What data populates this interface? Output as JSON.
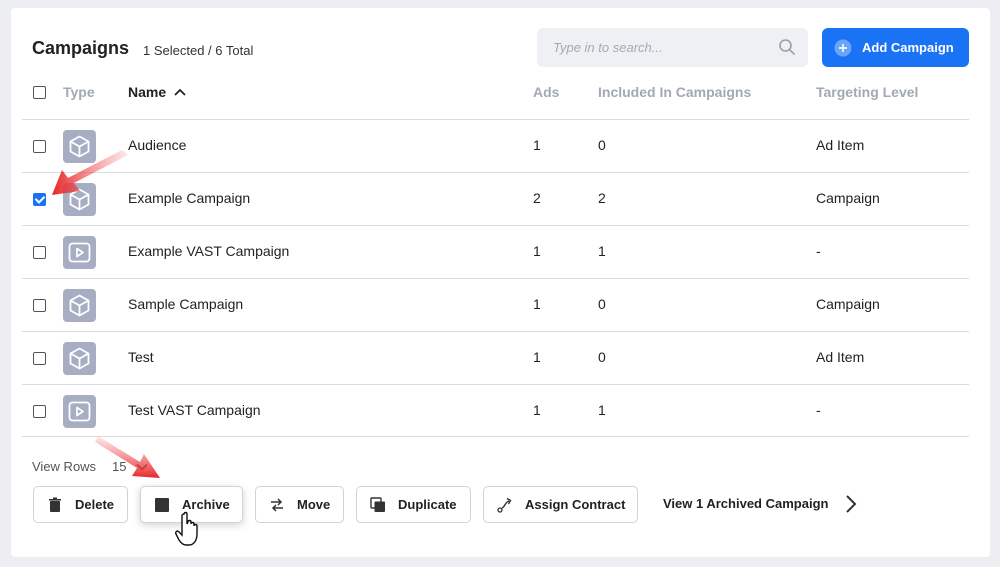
{
  "header": {
    "title": "Campaigns",
    "selection_count": "1 Selected / 6 Total",
    "search_placeholder": "Type in to search...",
    "add_button": "Add Campaign"
  },
  "columns": {
    "type": "Type",
    "name": "Name",
    "ads": "Ads",
    "included": "Included In Campaigns",
    "targeting": "Targeting Level"
  },
  "rows": [
    {
      "name": "Audience",
      "ads": "1",
      "included": "0",
      "targeting": "Ad Item",
      "icon": "cube-icon",
      "checked": false
    },
    {
      "name": "Example Campaign",
      "ads": "2",
      "included": "2",
      "targeting": "Campaign",
      "icon": "cube-icon",
      "checked": true
    },
    {
      "name": "Example VAST Campaign",
      "ads": "1",
      "included": "1",
      "targeting": "-",
      "icon": "video-play-icon",
      "checked": false
    },
    {
      "name": "Sample Campaign",
      "ads": "1",
      "included": "0",
      "targeting": "Campaign",
      "icon": "cube-icon",
      "checked": false
    },
    {
      "name": "Test",
      "ads": "1",
      "included": "0",
      "targeting": "Ad Item",
      "icon": "cube-icon",
      "checked": false
    },
    {
      "name": "Test VAST Campaign",
      "ads": "1",
      "included": "1",
      "targeting": "-",
      "icon": "video-play-icon",
      "checked": false
    }
  ],
  "footer": {
    "view_rows_label": "View Rows",
    "view_rows_value": "15",
    "actions": {
      "delete": "Delete",
      "archive": "Archive",
      "move": "Move",
      "duplicate": "Duplicate",
      "assign_contract": "Assign Contract"
    },
    "archived_link": "View 1 Archived Campaign"
  },
  "colors": {
    "accent": "#1a73f5",
    "annotation_arrow": "#e8262a",
    "type_icon_bg": "#a7aec3"
  }
}
